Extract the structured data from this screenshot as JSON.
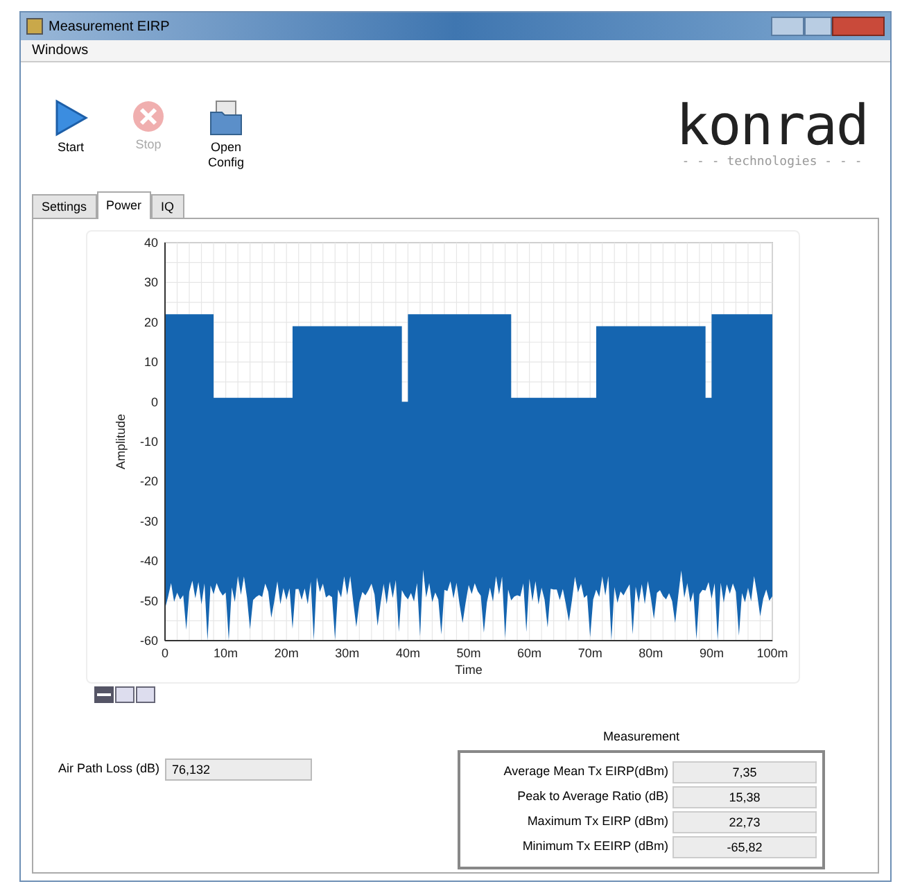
{
  "window": {
    "title": "Measurement EIRP"
  },
  "menu": [
    "Windows"
  ],
  "toolbar": [
    {
      "kind": "start",
      "label": "Start",
      "disabled": false
    },
    {
      "kind": "stop",
      "label": "Stop",
      "disabled": true
    },
    {
      "kind": "open",
      "label": "Open Config",
      "disabled": false
    }
  ],
  "logo": {
    "name": "konrad",
    "tagline": "- - - technologies - - -"
  },
  "tabs": [
    {
      "label": "Settings",
      "selected": false
    },
    {
      "label": "Power",
      "selected": true
    },
    {
      "label": "IQ",
      "selected": false
    }
  ],
  "plot": {
    "xlabel": "Time",
    "ylabel": "Amplitude",
    "yticks": [
      "40",
      "30",
      "20",
      "10",
      "0",
      "-10",
      "-20",
      "-30",
      "-40",
      "-50",
      "-60"
    ],
    "xticks": [
      "0",
      "10m",
      "20m",
      "30m",
      "40m",
      "50m",
      "60m",
      "70m",
      "80m",
      "90m",
      "100m"
    ]
  },
  "air_path_loss": {
    "label": "Air Path Loss (dB)",
    "value": "76,132"
  },
  "measurement": {
    "title": "Measurement",
    "rows": [
      {
        "label": "Average Mean Tx EIRP(dBm)",
        "value": "7,35"
      },
      {
        "label": "Peak to Average Ratio (dB)",
        "value": "15,38"
      },
      {
        "label": "Maximum Tx EIRP (dBm)",
        "value": "22,73"
      },
      {
        "label": "Minimum Tx EEIRP (dBm)",
        "value": "-65,82"
      }
    ]
  }
}
